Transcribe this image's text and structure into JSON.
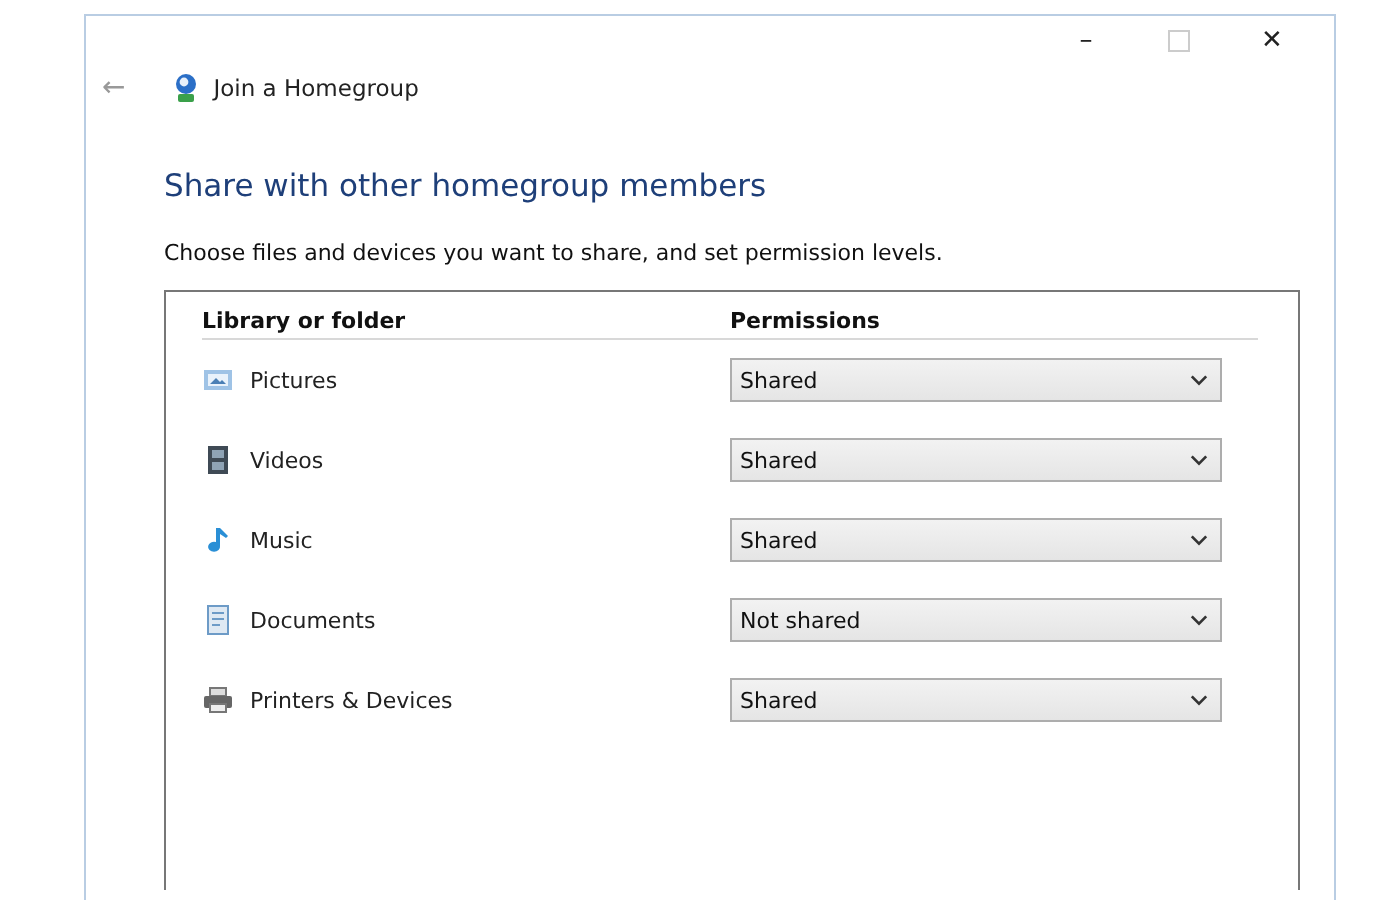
{
  "window": {
    "controls": {
      "minimize": "–",
      "maximize_disabled": true,
      "close": "✕"
    }
  },
  "nav": {
    "back": "←",
    "title": "Join a Homegroup"
  },
  "heading": "Share with other homegroup members",
  "description": "Choose files and devices you want to share, and set permission levels.",
  "table": {
    "columns": [
      "Library or folder",
      "Permissions"
    ],
    "rows": [
      {
        "kind": "pictures",
        "name": "Pictures",
        "permission": "Shared"
      },
      {
        "kind": "videos",
        "name": "Videos",
        "permission": "Shared"
      },
      {
        "kind": "music",
        "name": "Music",
        "permission": "Shared"
      },
      {
        "kind": "documents",
        "name": "Documents",
        "permission": "Not shared"
      },
      {
        "kind": "printers",
        "name": "Printers & Devices",
        "permission": "Shared"
      }
    ]
  }
}
